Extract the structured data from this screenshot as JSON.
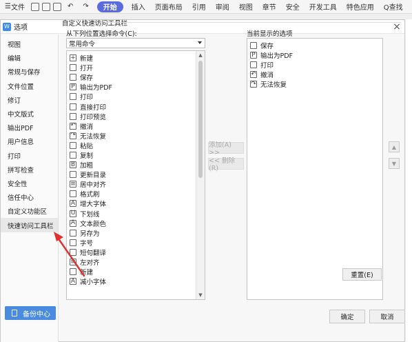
{
  "ribbon": {
    "file_label": "文件",
    "start_label": "开始",
    "tabs": [
      "插入",
      "页面布局",
      "引用",
      "审阅",
      "视图",
      "章节",
      "安全",
      "开发工具",
      "特色应用"
    ],
    "search_label": "Q查找"
  },
  "dialog": {
    "title": "选项",
    "close_glyph": "×"
  },
  "sidebar": {
    "items": [
      "视图",
      "编辑",
      "常规与保存",
      "文件位置",
      "修订",
      "中文版式",
      "输出PDF",
      "用户信息",
      "打印",
      "拼写检查",
      "安全性",
      "信任中心",
      "自定义功能区",
      "快速访问工具栏"
    ],
    "active_index": 13,
    "backup_label": "备份中心"
  },
  "main": {
    "title": "自定义快速访问工具栏",
    "from_label": "从下列位置选择命令(C):",
    "select_value": "常用命令",
    "current_label": "当前显示的选项",
    "commands": [
      {
        "label": "新建",
        "icon": "new-doc-icon",
        "glyph": "+"
      },
      {
        "label": "打开",
        "icon": "folder-icon",
        "glyph": ""
      },
      {
        "label": "保存",
        "icon": "save-icon",
        "glyph": ""
      },
      {
        "label": "输出为PDF",
        "icon": "pdf-icon",
        "glyph": "P"
      },
      {
        "label": "打印",
        "icon": "printer-icon",
        "glyph": ""
      },
      {
        "label": "直接打印",
        "icon": "quick-print-icon",
        "glyph": ""
      },
      {
        "label": "打印预览",
        "icon": "print-preview-icon",
        "glyph": ""
      },
      {
        "label": "撤消",
        "icon": "undo-icon",
        "glyph": "↶"
      },
      {
        "label": "无法恢复",
        "icon": "redo-icon",
        "glyph": "↷"
      },
      {
        "label": "粘贴",
        "icon": "paste-icon",
        "glyph": ""
      },
      {
        "label": "复制",
        "icon": "copy-icon",
        "glyph": ""
      },
      {
        "label": "加粗",
        "icon": "bold-icon",
        "glyph": "B"
      },
      {
        "label": "更新目录",
        "icon": "update-toc-icon",
        "glyph": ""
      },
      {
        "label": "居中对齐",
        "icon": "align-center-icon",
        "glyph": "≡"
      },
      {
        "label": "格式刷",
        "icon": "format-painter-icon",
        "glyph": ""
      },
      {
        "label": "增大字体",
        "icon": "font-increase-icon",
        "glyph": "A"
      },
      {
        "label": "下划线",
        "icon": "underline-icon",
        "glyph": "U"
      },
      {
        "label": "文本颜色",
        "icon": "font-color-icon",
        "glyph": "A"
      },
      {
        "label": "另存为",
        "icon": "save-as-icon",
        "glyph": ""
      },
      {
        "label": "字号",
        "icon": "font-size-icon",
        "glyph": ""
      },
      {
        "label": "短句翻译",
        "icon": "translate-icon",
        "glyph": ""
      },
      {
        "label": "左对齐",
        "icon": "align-left-icon",
        "glyph": "≡"
      },
      {
        "label": "新建",
        "icon": "new-doc-icon",
        "glyph": ""
      },
      {
        "label": "减小字体",
        "icon": "font-decrease-icon",
        "glyph": "A"
      }
    ],
    "current": [
      {
        "label": "保存",
        "icon": "save-icon",
        "glyph": ""
      },
      {
        "label": "输出为PDF",
        "icon": "pdf-icon",
        "glyph": "P"
      },
      {
        "label": "打印",
        "icon": "printer-icon",
        "glyph": ""
      },
      {
        "label": "撤消",
        "icon": "undo-icon",
        "glyph": "↶"
      },
      {
        "label": "无法恢复",
        "icon": "redo-icon",
        "glyph": "↷"
      }
    ],
    "add_label": "添加(A) >>",
    "remove_label": "<< 删除(R)",
    "up_glyph": "▲",
    "down_glyph": "▼",
    "reset_label": "重置(E)"
  },
  "footer": {
    "ok_label": "确定",
    "cancel_label": "取消"
  },
  "colors": {
    "accent": "#4a8be0",
    "start_tab": "#5a6be0",
    "arrow": "#e03030"
  }
}
